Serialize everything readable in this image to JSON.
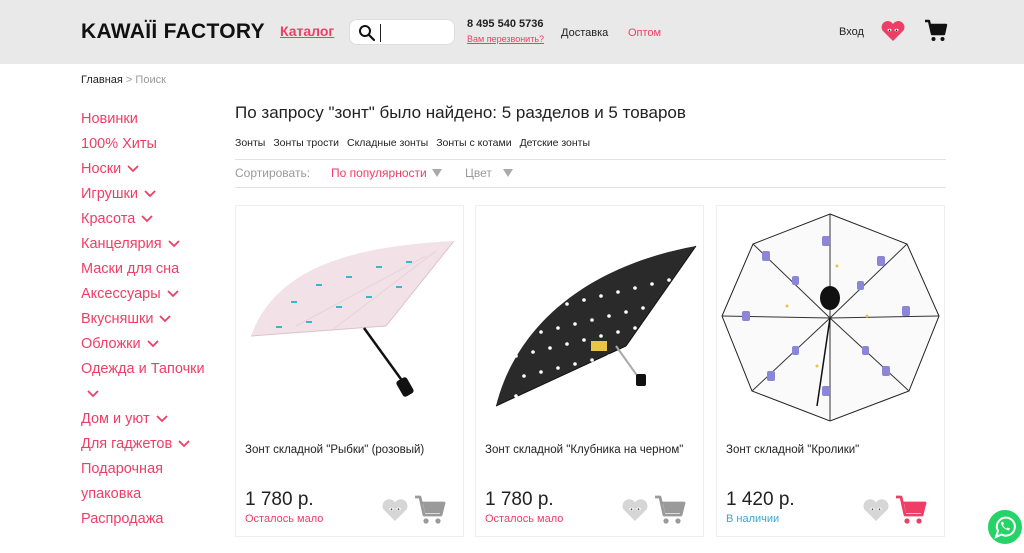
{
  "header": {
    "logo": "KAWAÏİ FACTORY",
    "catalog_label": "Каталог",
    "search_placeholder": "",
    "phone": "8 495 540 5736",
    "callback_label": "Вам перезвонить?",
    "delivery_label": "Доставка",
    "wholesale_label": "Оптом",
    "login_label": "Вход"
  },
  "breadcrumb": {
    "home": "Главная",
    "separator": " > ",
    "current": "Поиск"
  },
  "sidebar": {
    "items": [
      {
        "label": "Новинки",
        "chevron": false
      },
      {
        "label": "100% Хиты",
        "chevron": false
      },
      {
        "label": "Носки",
        "chevron": true
      },
      {
        "label": "Игрушки",
        "chevron": true
      },
      {
        "label": "Красота",
        "chevron": true
      },
      {
        "label": "Канцелярия",
        "chevron": true
      },
      {
        "label": "Маски для сна",
        "chevron": false
      },
      {
        "label": "Аксессуары",
        "chevron": true
      },
      {
        "label": "Вкусняшки",
        "chevron": true
      },
      {
        "label": "Обложки",
        "chevron": true
      },
      {
        "label": "Одежда и Тапочки",
        "chevron": true
      },
      {
        "label": "Дом и уют",
        "chevron": true
      },
      {
        "label": "Для гаджетов",
        "chevron": true
      },
      {
        "label": "Подарочная упаковка",
        "chevron": false
      },
      {
        "label": "Распродажа",
        "chevron": false
      }
    ]
  },
  "main": {
    "results_title": "По запросу \"зонт\" было найдено: 5 разделов и 5 товаров",
    "subcategories": [
      "Зонты",
      "Зонты трости",
      "Складные зонты",
      "Зонты с котами",
      "Детские зонты"
    ],
    "sort_label": "Сортировать:",
    "sort_value": "По популярности",
    "color_label": "Цвет"
  },
  "products": [
    {
      "name": "Зонт складной \"Рыбки\" (розовый)",
      "price": "1 780 р.",
      "stock": "Осталось мало",
      "stock_color": "#ef3e66",
      "cart_color": "#9a9a9a",
      "image": "pink-umbrella"
    },
    {
      "name": "Зонт складной \"Клубника на черном\"",
      "price": "1 780 р.",
      "stock": "Осталось мало",
      "stock_color": "#ef3e66",
      "cart_color": "#9a9a9a",
      "image": "black-umbrella"
    },
    {
      "name": "Зонт складной \"Кролики\"",
      "price": "1 420 р.",
      "stock": "В наличии",
      "stock_color": "#3aa6d8",
      "cart_color": "#ef3e66",
      "image": "white-umbrella"
    }
  ],
  "colors": {
    "accent": "#ef3e66",
    "header_bg": "#e9e9e9",
    "in_stock": "#3aa6d8",
    "whatsapp": "#25d366"
  }
}
